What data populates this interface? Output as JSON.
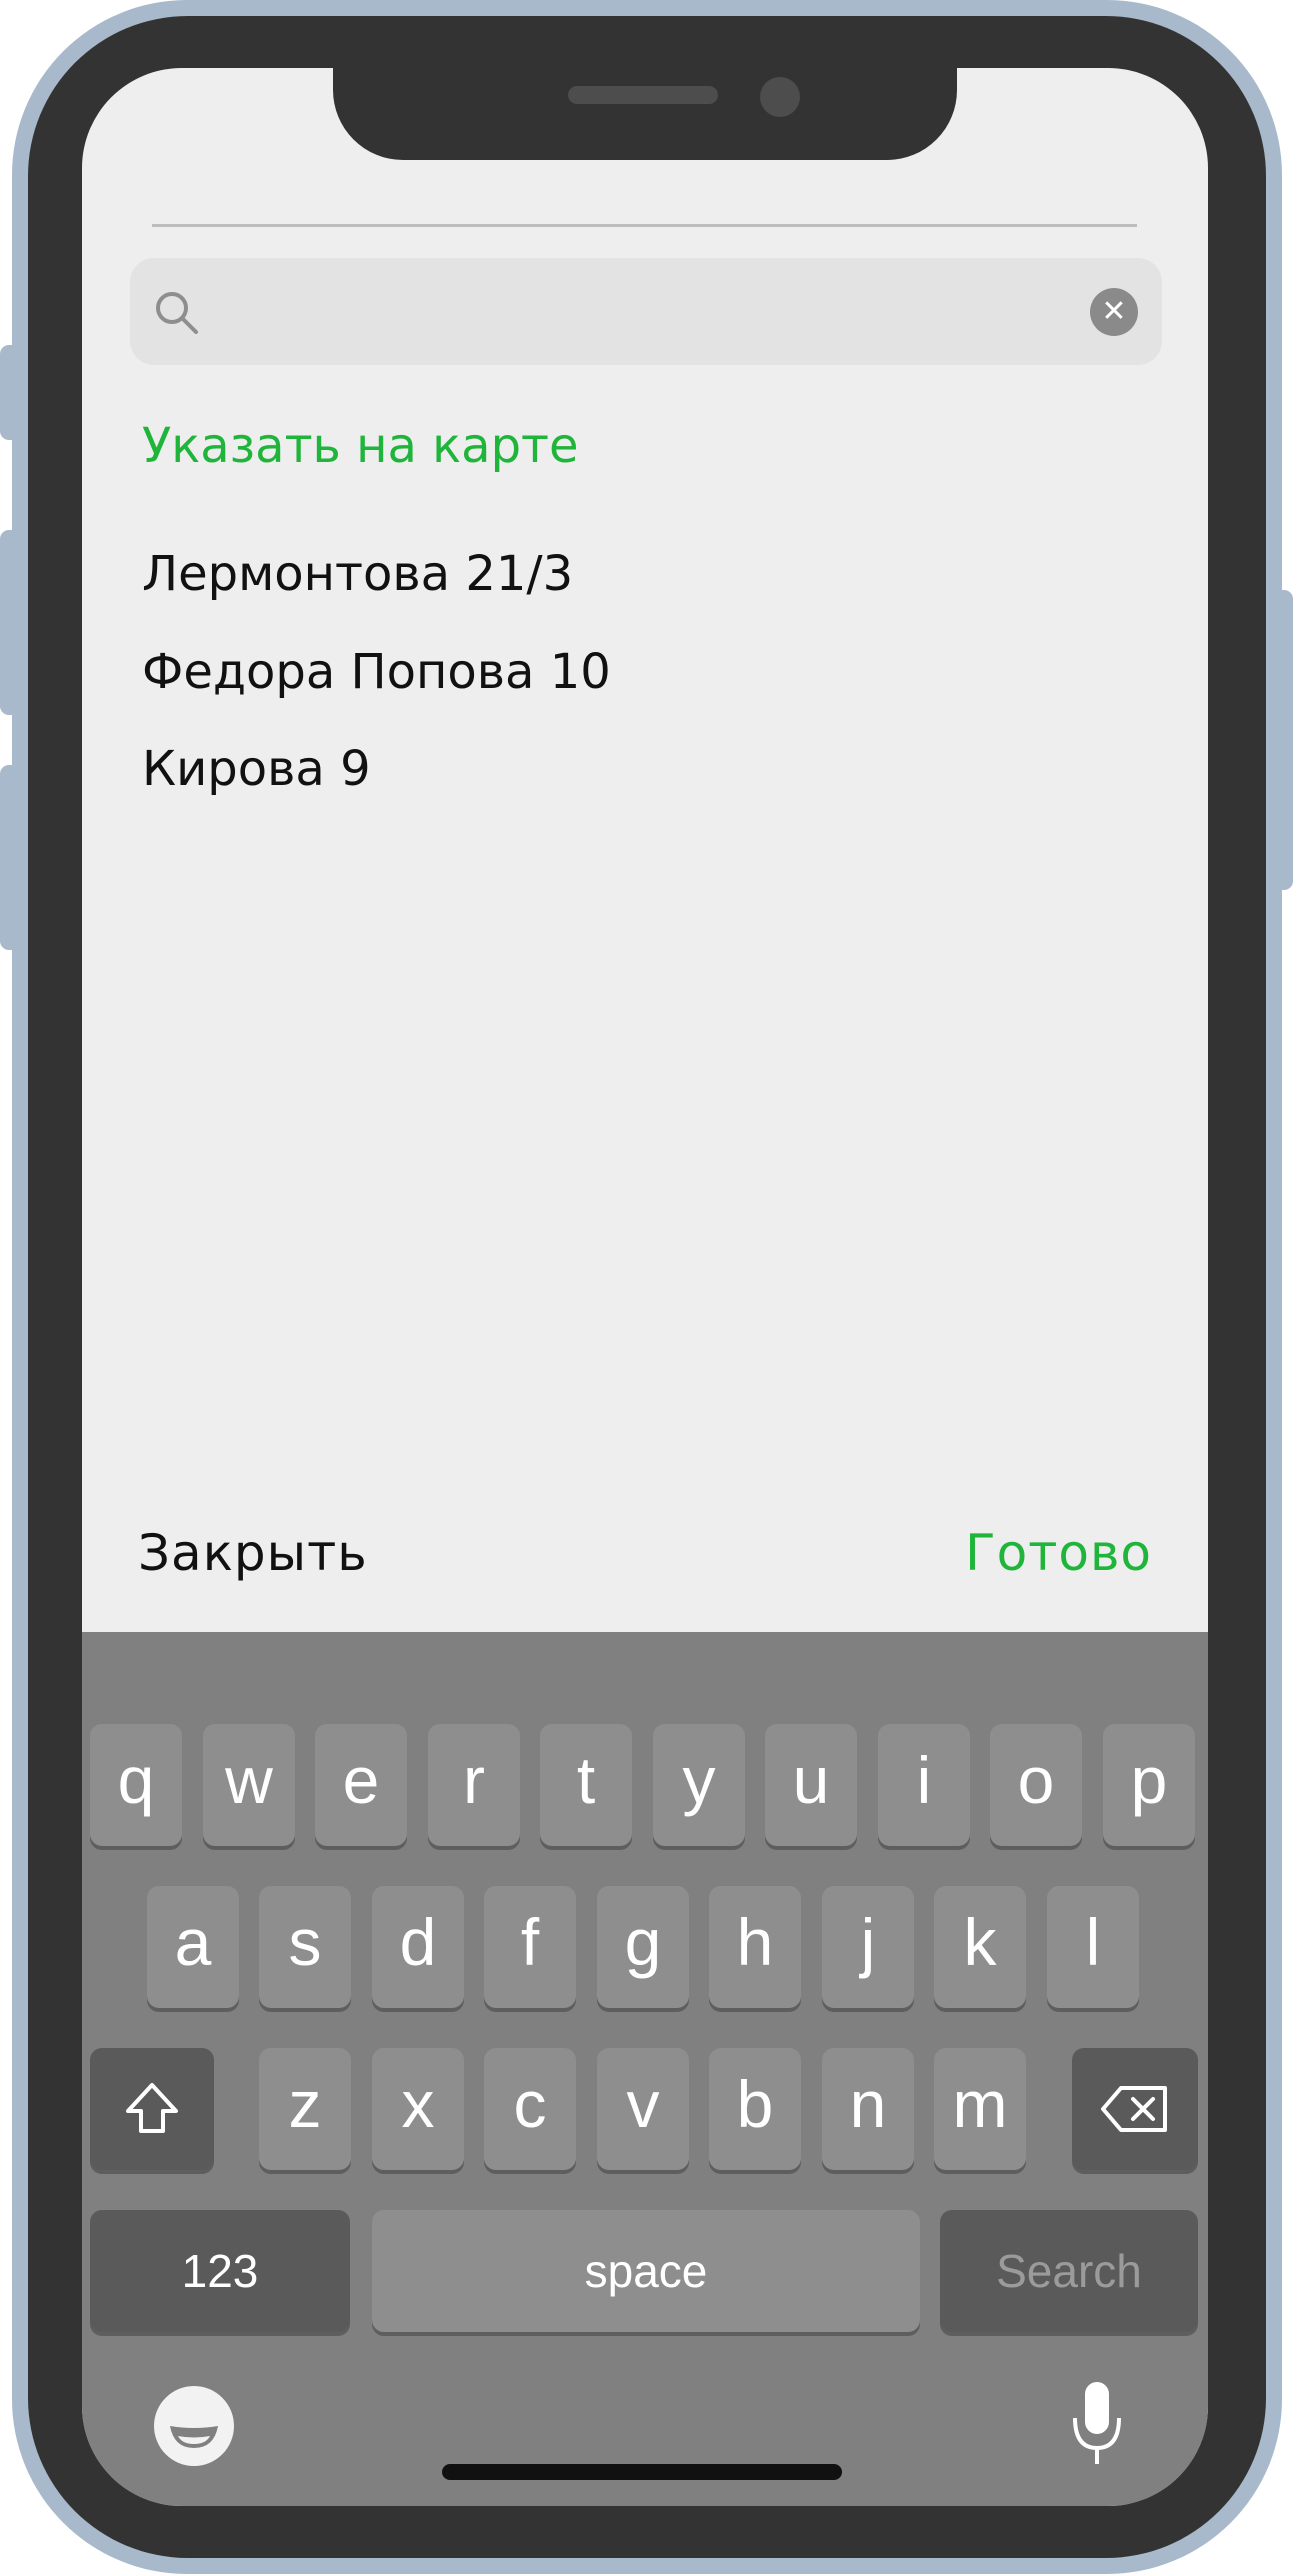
{
  "search": {
    "value": "",
    "placeholder": "",
    "clear_symbol": "✕"
  },
  "map_link": "Указать на карте",
  "addresses": [
    "Лермонтова 21/3",
    "Федора Попова 10",
    "Кирова 9"
  ],
  "footer": {
    "close_label": "Закрыть",
    "done_label": "Готово"
  },
  "keyboard": {
    "row1": [
      "q",
      "w",
      "e",
      "r",
      "t",
      "y",
      "u",
      "i",
      "o",
      "p"
    ],
    "row2": [
      "a",
      "s",
      "d",
      "f",
      "g",
      "h",
      "j",
      "k",
      "l"
    ],
    "row3": [
      "z",
      "x",
      "c",
      "v",
      "b",
      "n",
      "m"
    ],
    "numbers_label": "123",
    "space_label": "space",
    "search_label": "Search"
  },
  "colors": {
    "accent": "#1fb43a",
    "screen_bg": "#eeeeee",
    "keyboard_bg": "#808080",
    "frame": "#a8b9cb"
  },
  "icons": [
    "search-icon",
    "clear-icon",
    "shift-icon",
    "backspace-icon",
    "emoji-icon",
    "microphone-icon"
  ]
}
